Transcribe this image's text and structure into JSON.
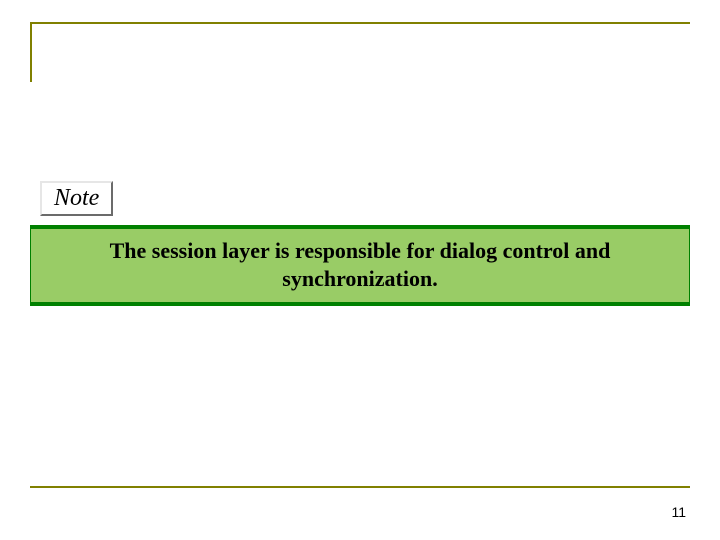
{
  "note": {
    "label": "Note"
  },
  "callout": {
    "text": "The session layer is responsible for dialog control and synchronization."
  },
  "page": {
    "number": "11"
  }
}
